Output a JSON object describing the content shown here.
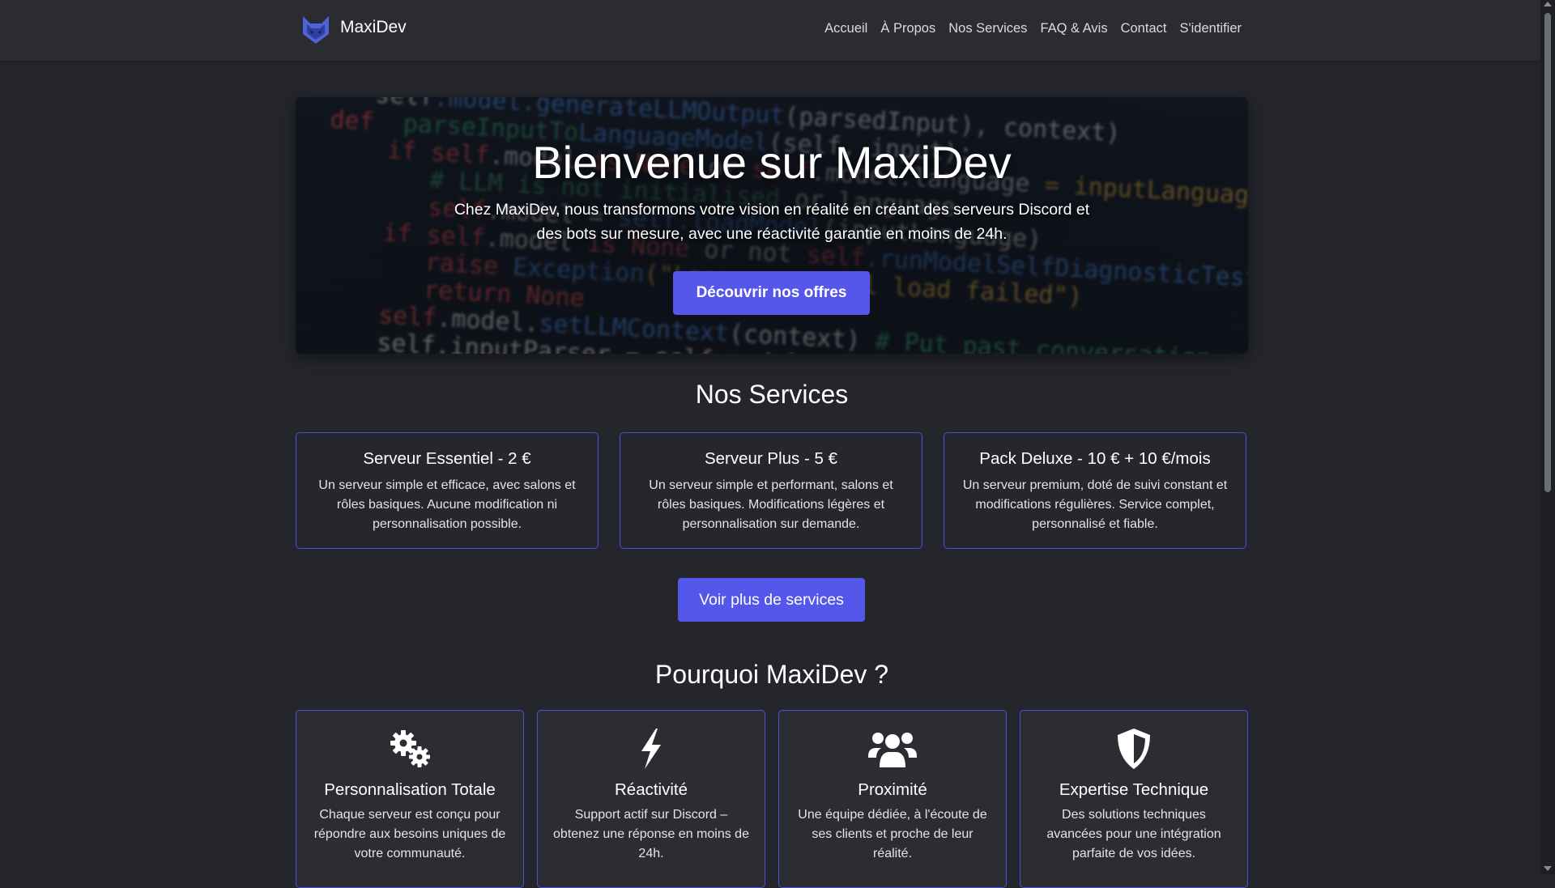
{
  "nav": {
    "brand": "MaxiDev",
    "links": [
      "Accueil",
      "À Propos",
      "Nos Services",
      "FAQ & Avis",
      "Contact",
      "S'identifier"
    ]
  },
  "hero": {
    "title": "Bienvenue sur MaxiDev",
    "text": "Chez MaxiDev, nous transformons votre vision en réalité en créant des serveurs Discord et des bots sur mesure, avec une réactivité garantie en moins de 24h.",
    "button": "Découvrir nos offres"
  },
  "services": {
    "title": "Nos Services",
    "cards": [
      {
        "title": "Serveur Essentiel - 2 €",
        "text": "Un serveur simple et efficace, avec salons et rôles basiques. Aucune modification ni personnalisation possible."
      },
      {
        "title": "Serveur Plus - 5 €",
        "text": "Un serveur simple et performant, salons et rôles basiques. Modifications légères et personnalisation sur demande."
      },
      {
        "title": "Pack Deluxe - 10 € + 10 €/mois",
        "text": "Un serveur premium, doté de suivi constant et modifications régulières. Service complet, personnalisé et fiable."
      }
    ],
    "more_button": "Voir plus de services"
  },
  "why": {
    "title": "Pourquoi MaxiDev ?",
    "cards": [
      {
        "icon": "gears-icon",
        "title": "Personnalisation Totale",
        "text": "Chaque serveur est conçu pour répondre aux besoins uniques de votre communauté."
      },
      {
        "icon": "bolt-icon",
        "title": "Réactivité",
        "text": "Support actif sur Discord – obtenez une réponse en moins de 24h."
      },
      {
        "icon": "users-icon",
        "title": "Proximité",
        "text": "Une équipe dédiée, à l'écoute de ses clients et proche de leur réalité."
      },
      {
        "icon": "shield-icon",
        "title": "Expertise Technique",
        "text": "Des solutions techniques avancées pour une intégration parfaite de vos idées."
      }
    ]
  },
  "colors": {
    "background": "#24262c",
    "navbar": "#2a2c32",
    "accent": "#5457ea",
    "card_border": "#4d4fd4"
  }
}
